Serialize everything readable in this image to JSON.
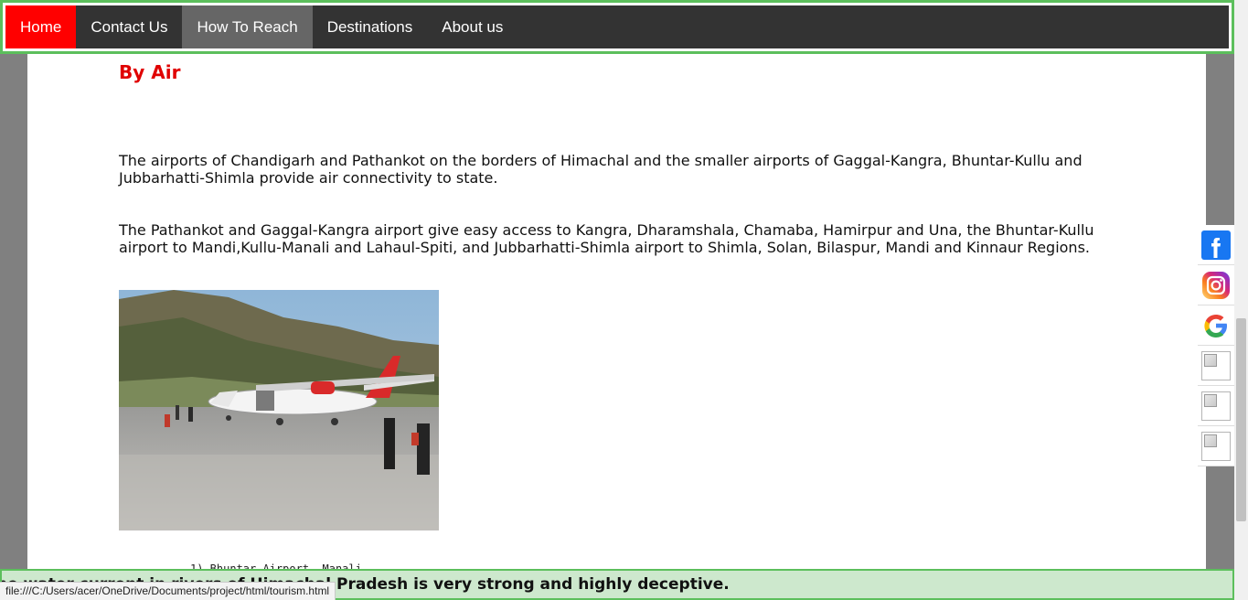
{
  "nav": {
    "items": [
      {
        "label": "Home"
      },
      {
        "label": "Contact Us"
      },
      {
        "label": "How To Reach"
      },
      {
        "label": "Destinations"
      },
      {
        "label": "About us"
      }
    ],
    "active_color": "#ff0000",
    "bar_color": "#333333"
  },
  "main": {
    "heading": "By Air",
    "paragraphs": [
      "The airports of Chandigarh and Pathankot on the borders of Himachal and the smaller airports of Gaggal-Kangra, Bhuntar-Kullu and Jubbarhatti-Shimla provide air connectivity to state.",
      "The Pathankot and Gaggal-Kangra airport give easy access to Kangra, Dharamshala, Chamaba, Hamirpur and Una, the Bhuntar-Kullu airport to Mandi,Kullu-Manali and Lahaul-Spiti, and Jubbarhatti-Shimla airport to Shimla, Solan, Bilaspur, Mandi and Kinnaur Regions."
    ],
    "list_item": "1)  Bhuntar Airport, Manali"
  },
  "social": {
    "icons": [
      "facebook-icon",
      "instagram-icon",
      "google-icon",
      "broken-image-icon",
      "broken-image-icon",
      "broken-image-icon"
    ]
  },
  "marquee": {
    "text": "he water current in rivers of Himachal Pradesh is very strong and highly deceptive."
  },
  "status": {
    "url": "file:///C:/Users/acer/OneDrive/Documents/project/html/tourism.html"
  },
  "colors": {
    "heading": "#e00000",
    "marquee_bg": "#cde8cd",
    "border_green": "#5cbf5c",
    "backdrop": "#808080"
  }
}
